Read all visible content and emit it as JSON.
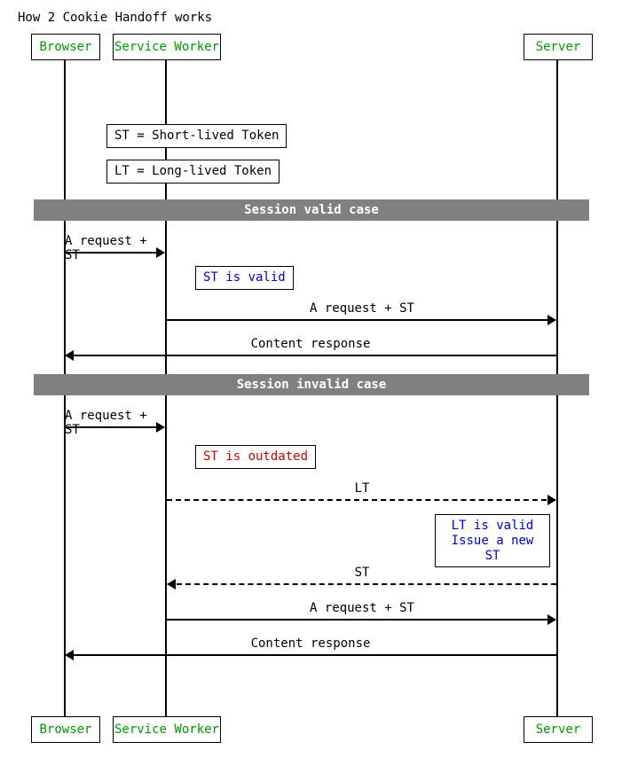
{
  "title": "How 2 Cookie Handoff works",
  "participants": {
    "browser": "Browser",
    "serviceWorker": "Service Worker",
    "server": "Server"
  },
  "legend": {
    "st": "ST = Short-lived Token",
    "lt": "LT = Long-lived Token"
  },
  "sections": {
    "valid": "Session valid case",
    "invalid": "Session invalid case"
  },
  "notes": {
    "stValid": "ST is valid",
    "stOutdated": "ST is outdated",
    "ltValidL1": "LT is valid",
    "ltValidL2": "Issue a new ST"
  },
  "messages": {
    "reqST": "A request + ST",
    "content": "Content response",
    "lt": "LT",
    "st": "ST"
  }
}
